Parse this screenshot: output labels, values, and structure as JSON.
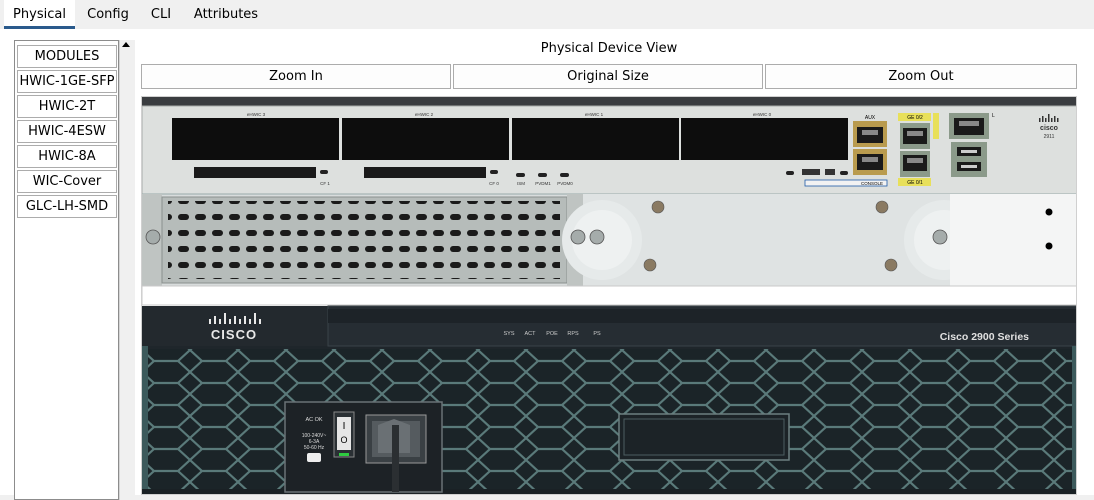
{
  "tabs": [
    {
      "label": "Physical",
      "active": true
    },
    {
      "label": "Config",
      "active": false
    },
    {
      "label": "CLI",
      "active": false
    },
    {
      "label": "Attributes",
      "active": false
    }
  ],
  "modules": [
    "MODULES",
    "HWIC-1GE-SFP",
    "HWIC-2T",
    "HWIC-4ESW",
    "HWIC-8A",
    "WIC-Cover",
    "GLC-LH-SMD"
  ],
  "viewer": {
    "title": "Physical Device View",
    "zoom_in": "Zoom In",
    "original_size": "Original Size",
    "zoom_out": "Zoom Out"
  },
  "device": {
    "ehwic_labels": [
      "eHWIC 3",
      "eHWIC 2",
      "eHWIC 1",
      "eHWIC 0"
    ],
    "cf_labels": [
      "CF 1",
      "CF 0"
    ],
    "led_labels": [
      "ISM",
      "PVDM1",
      "PVDM0"
    ],
    "port_labels": {
      "aux": "AUX",
      "console": "CONSOLE",
      "ge02": "GE 0/2",
      "ge01": "GE 0/1",
      "eth": "L"
    },
    "brand_small": "cisco",
    "model_small": "2911",
    "front_brand": "CISCO",
    "status_leds": [
      "SYS",
      "ACT",
      "POE",
      "RPS",
      "PS"
    ],
    "series": "Cisco 2900 Series",
    "psu": {
      "ac_ok": "AC OK",
      "rating_1": "100-240V~",
      "rating_2": "6-3A",
      "rating_3": "50-60 Hz",
      "switch_on": "I",
      "switch_off": "O"
    }
  },
  "colors": {
    "tab_active_underline": "#2a5a8c",
    "chassis": "#1c2329",
    "panel_grey": "#c8ccc9",
    "hex_line": "#5a7a7a"
  }
}
